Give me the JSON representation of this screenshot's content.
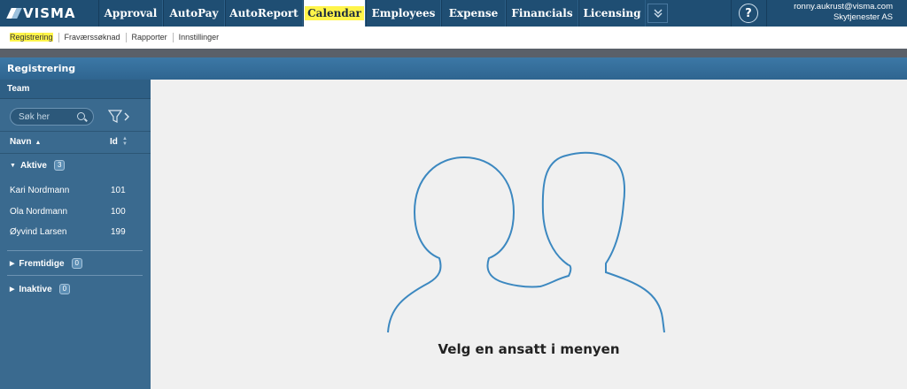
{
  "brand": {
    "name": "VISMA"
  },
  "topnav": {
    "tabs": [
      {
        "label": "Approval"
      },
      {
        "label": "AutoPay"
      },
      {
        "label": "AutoReport"
      },
      {
        "label": "Calendar",
        "active": true
      },
      {
        "label": "Employees"
      },
      {
        "label": "Expense"
      },
      {
        "label": "Financials"
      },
      {
        "label": "Licensing"
      }
    ],
    "more_icon": "chevron-double-down-icon",
    "help_label": "?"
  },
  "user": {
    "email": "ronny.aukrust@visma.com",
    "company": "Skytjenester AS"
  },
  "subnav": {
    "items": [
      {
        "label": "Registrering",
        "active": true
      },
      {
        "label": "Fraværssøknad"
      },
      {
        "label": "Rapporter"
      },
      {
        "label": "Innstillinger"
      }
    ]
  },
  "page": {
    "title": "Registrering"
  },
  "sidebar": {
    "team_label": "Team",
    "search_placeholder": "Søk her",
    "columns": {
      "name": "Navn",
      "id": "Id"
    },
    "groups": {
      "aktive": {
        "label": "Aktive",
        "count": "3"
      },
      "fremtidige": {
        "label": "Fremtidige",
        "count": "0"
      },
      "inaktive": {
        "label": "Inaktive",
        "count": "0"
      }
    },
    "employees": [
      {
        "name": "Kari Nordmann",
        "id": "101"
      },
      {
        "name": "Ola Nordmann",
        "id": "100"
      },
      {
        "name": "Øyvind Larsen",
        "id": "199"
      }
    ]
  },
  "main": {
    "prompt": "Velg en ansatt i menyen"
  },
  "colors": {
    "nav": "#1f4e73",
    "sidebar": "#3a6a8f",
    "highlight": "#fff44a"
  }
}
